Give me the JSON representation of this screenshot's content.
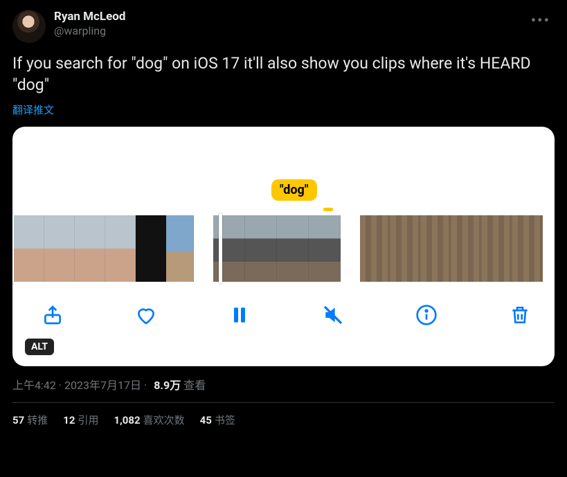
{
  "author": {
    "display_name": "Ryan McLeod",
    "handle": "@warpling"
  },
  "tweet_text": "If you search for \"dog\" on iOS 17 it'll also show you clips where it's HEARD \"dog\"",
  "translate_label": "翻译推文",
  "media": {
    "search_badge": "\"dog\"",
    "alt_label": "ALT"
  },
  "meta": {
    "time": "上午4:42",
    "dot1": " · ",
    "date": "2023年7月17日",
    "dot2": " · ",
    "views_num": "8.9万",
    "views_label": " 查看"
  },
  "stats": {
    "retweets_num": "57",
    "retweets_label": "转推",
    "quotes_num": "12",
    "quotes_label": "引用",
    "likes_num": "1,082",
    "likes_label": "喜欢次数",
    "bookmarks_num": "45",
    "bookmarks_label": "书签"
  }
}
